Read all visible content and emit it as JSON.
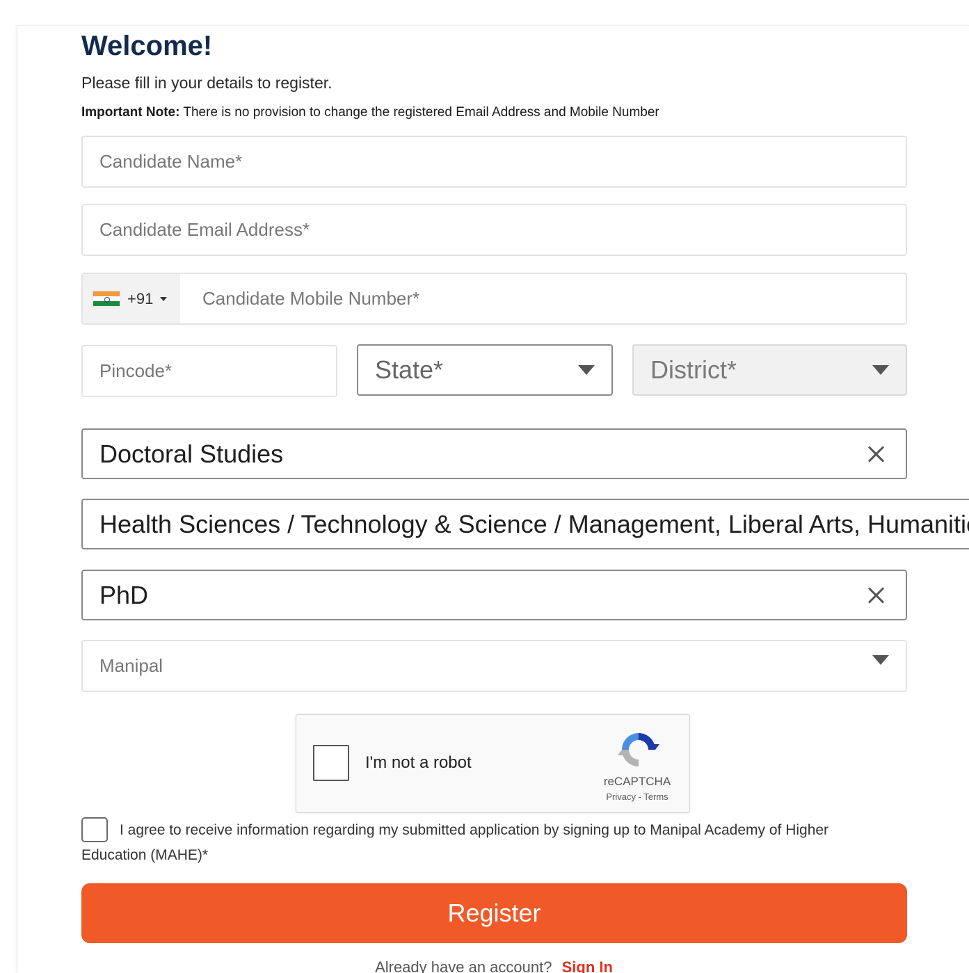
{
  "header": {
    "title": "Welcome!",
    "subtitle": "Please fill in your details to register.",
    "note_label": "Important Note:",
    "note_text": "There is no provision to change the registered Email Address and Mobile Number"
  },
  "form": {
    "name_placeholder": "Candidate Name*",
    "email_placeholder": "Candidate Email Address*",
    "phone": {
      "dial_code": "+91",
      "placeholder": "Candidate Mobile Number*"
    },
    "pincode_placeholder": "Pincode*",
    "state_placeholder": "State*",
    "district_placeholder": "District*",
    "program_level": "Doctoral Studies",
    "discipline": "Health Sciences / Technology & Science / Management, Liberal Arts, Humanities & Commerce",
    "program": "PhD",
    "campus": "Manipal"
  },
  "captcha": {
    "label": "I'm not a robot",
    "brand": "reCAPTCHA",
    "links": "Privacy - Terms"
  },
  "consent": {
    "text": "I agree to receive information regarding my submitted application by signing up to Manipal Academy of Higher Education (MAHE)*"
  },
  "actions": {
    "register_label": "Register",
    "signin_prompt": "Already have an account?",
    "signin_link": "Sign In"
  },
  "colors": {
    "accent": "#f05a28",
    "title": "#142b4d",
    "link": "#e0311f"
  }
}
